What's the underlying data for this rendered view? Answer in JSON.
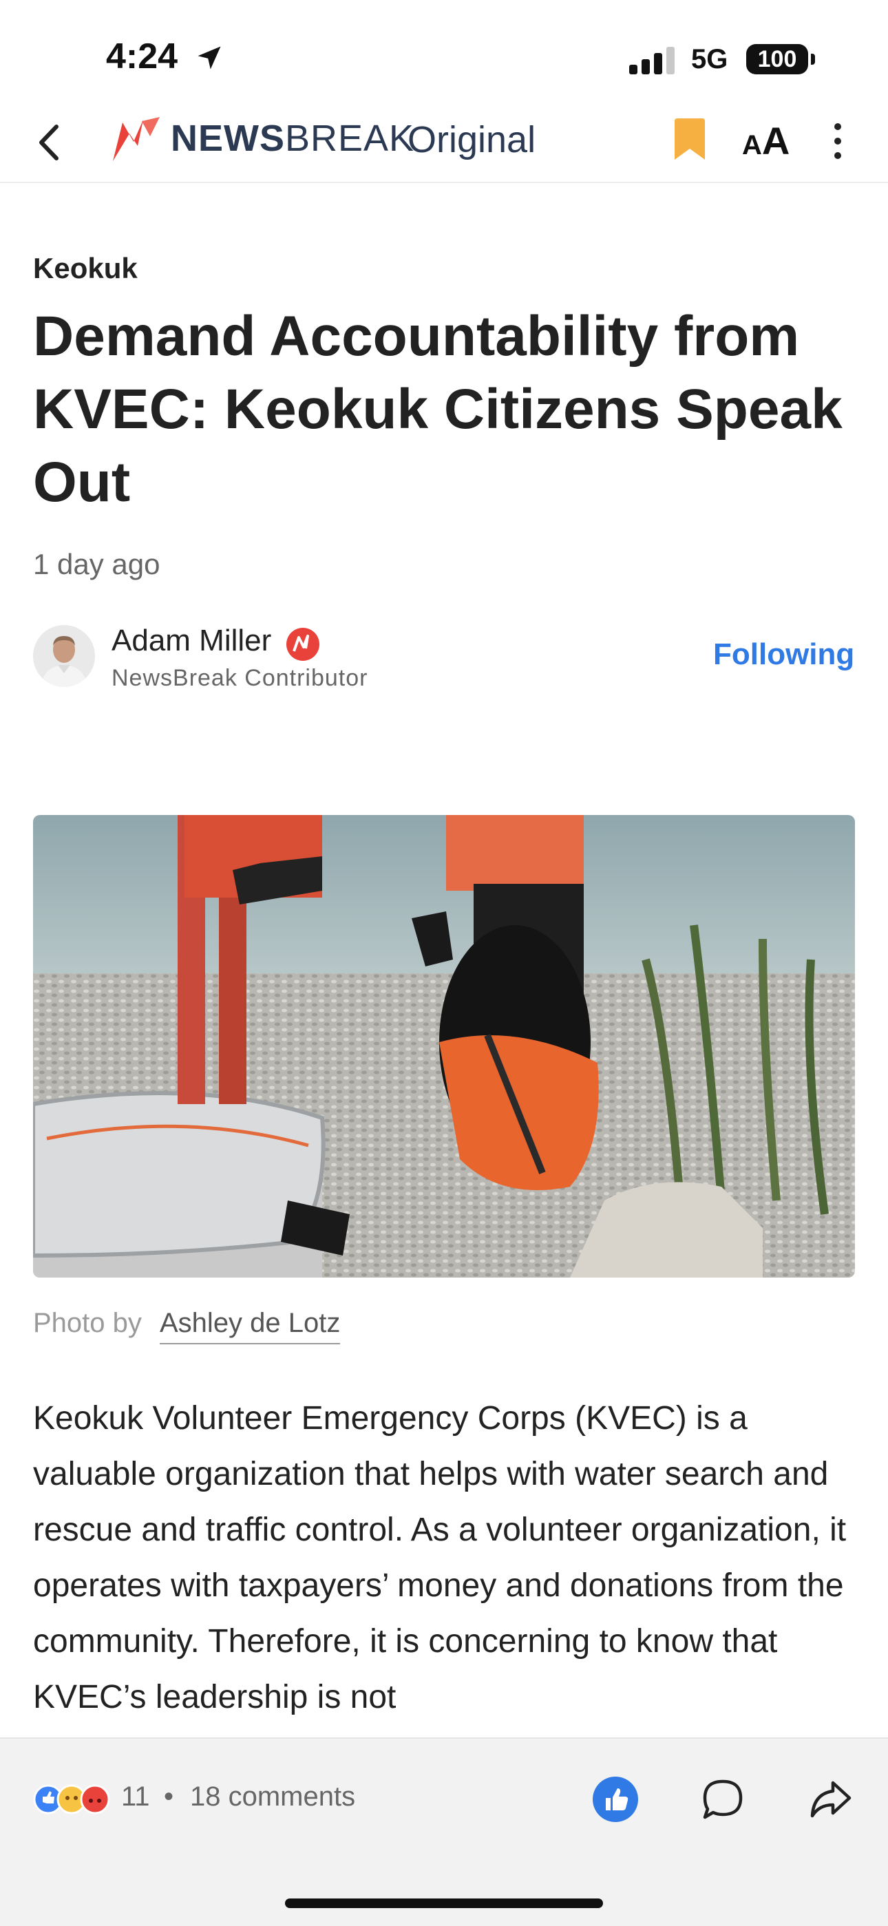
{
  "status": {
    "time": "4:24",
    "network": "5G",
    "battery": "100"
  },
  "nav": {
    "brand_news": "NEWS",
    "brand_break": "BREAK",
    "brand_original": "Original"
  },
  "article": {
    "location": "Keokuk",
    "headline": "Demand Accountability from KVEC: Keokuk Citizens Speak Out",
    "time_ago": "1 day ago",
    "author": {
      "name": "Adam Miller",
      "role": "NewsBreak Contributor",
      "follow_label": "Following"
    },
    "photo_credit_prefix": "Photo by",
    "photo_credit_name": "Ashley de Lotz",
    "body": "Keokuk Volunteer Emergency Corps (KVEC) is a valuable organization that helps with water search and rescue and traffic control. As a volunteer organization, it operates with taxpayers’ money and donations from the community. Therefore, it is concerning to know that KVEC’s leadership is not"
  },
  "bottom": {
    "reaction_count": "11",
    "separator": "•",
    "comments": "18 comments"
  },
  "colors": {
    "accent": "#2f7ae5",
    "brand_red": "#e8423a",
    "bookmark": "#f5b041"
  },
  "icons": [
    "location-arrow-icon",
    "signal-icon",
    "back-icon",
    "newsbreak-logo-icon",
    "bookmark-icon",
    "text-size-icon",
    "more-icon",
    "verified-badge-icon",
    "reactions-icon",
    "like-icon",
    "comment-icon",
    "share-icon"
  ]
}
